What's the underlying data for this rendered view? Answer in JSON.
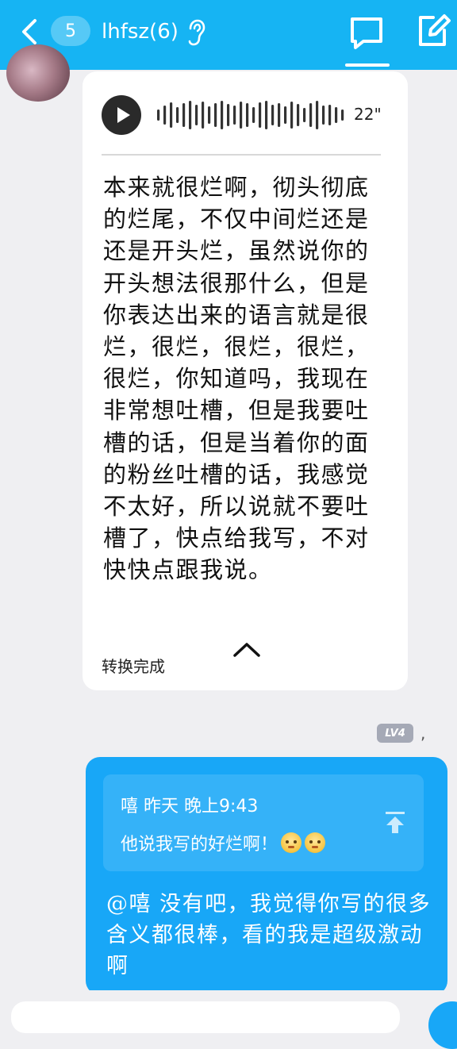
{
  "header": {
    "unread_count": "5",
    "title": "lhfsz(6)",
    "colors": {
      "background": "#16b4f3"
    }
  },
  "voice_message": {
    "duration": "22\"",
    "transcript": "本来就很烂啊，彻头彻底的烂尾，不仅中间烂还是还是开头烂，虽然说你的开头想法很那什么，但是你表达出来的语言就是很烂，很烂，很烂，很烂，很烂，你知道吗，我现在非常想吐槽，但是我要吐槽的话，但是当着你的面的粉丝吐槽的话，我感觉不太好，所以说就不要吐槽了，快点给我写，不对快快点跟我说。",
    "convert_status": "转换完成"
  },
  "level_badge": {
    "label": "LV4",
    "trailing": ","
  },
  "outgoing_message": {
    "quote": {
      "meta": "嘻 昨天 晚上9:43",
      "text": "他说我写的好烂啊！"
    },
    "text": "@嘻 没有吧，我觉得你写的很多含义都很棒，看的我是超级激动啊",
    "colors": {
      "bubble": "#18a7f7"
    }
  }
}
